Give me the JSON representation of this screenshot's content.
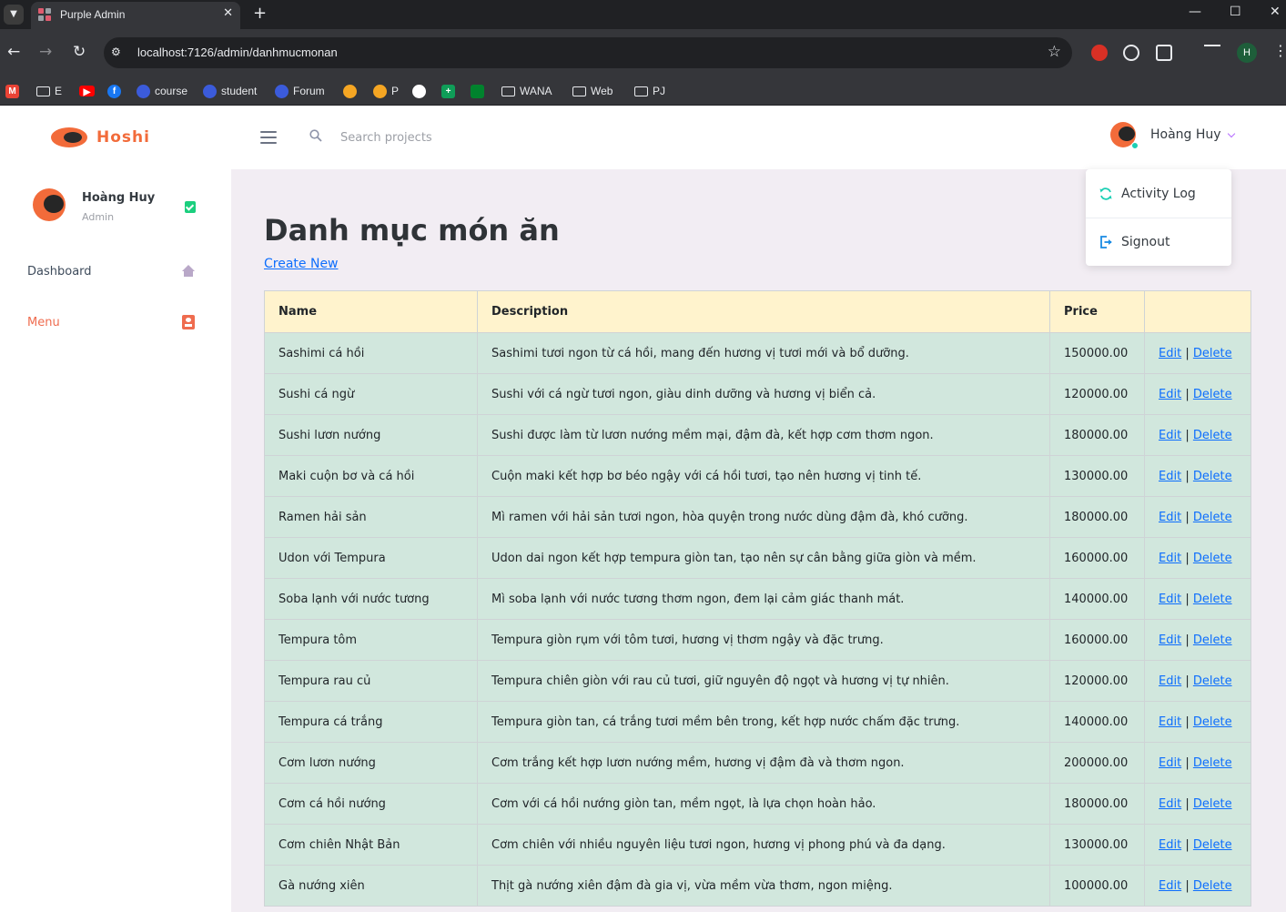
{
  "browser": {
    "tab_title": "Purple Admin",
    "url": "localhost:7126/admin/danhmucmonan",
    "profile_initial": "H",
    "bookmarks": [
      {
        "label": "",
        "icon": "gmail-icon"
      },
      {
        "label": "E",
        "icon": "folder-icon"
      },
      {
        "label": "",
        "icon": "youtube-icon"
      },
      {
        "label": "",
        "icon": "facebook-icon"
      },
      {
        "label": "course",
        "icon": "site-icon"
      },
      {
        "label": "student",
        "icon": "site-icon"
      },
      {
        "label": "Forum",
        "icon": "site-icon"
      },
      {
        "label": "",
        "icon": "site-icon"
      },
      {
        "label": "P",
        "icon": "site-icon"
      },
      {
        "label": "",
        "icon": "openai-icon"
      },
      {
        "label": "",
        "icon": "sheets-icon"
      },
      {
        "label": "",
        "icon": "meet-icon"
      },
      {
        "label": "WANA",
        "icon": "folder-icon"
      },
      {
        "label": "Web",
        "icon": "folder-icon"
      },
      {
        "label": "PJ",
        "icon": "folder-icon"
      }
    ]
  },
  "navbar": {
    "brand": "Hoshi",
    "search_placeholder": "Search projects",
    "profile_name": "Hoàng Huy"
  },
  "dropdown": {
    "items": [
      {
        "label": "Activity Log",
        "icon": "refresh-icon"
      },
      {
        "label": "Signout",
        "icon": "logout-icon"
      }
    ]
  },
  "sidebar": {
    "profile": {
      "name": "Hoàng Huy",
      "role": "Admin"
    },
    "items": [
      {
        "label": "Dashboard",
        "icon": "home-icon",
        "active": false
      },
      {
        "label": "Menu",
        "icon": "menu-book-icon",
        "active": true
      }
    ]
  },
  "main": {
    "title": "Danh mục món ăn",
    "create_link": "Create New",
    "table": {
      "headers": [
        "Name",
        "Description",
        "Price",
        ""
      ],
      "edit_label": "Edit",
      "delete_label": "Delete",
      "separator": "|",
      "rows": [
        {
          "name": "Sashimi cá hồi",
          "description": "Sashimi tươi ngon từ cá hồi, mang đến hương vị tươi mới và bổ dưỡng.",
          "price": "150000.00"
        },
        {
          "name": "Sushi cá ngừ",
          "description": "Sushi với cá ngừ tươi ngon, giàu dinh dưỡng và hương vị biển cả.",
          "price": "120000.00"
        },
        {
          "name": "Sushi lươn nướng",
          "description": "Sushi được làm từ lươn nướng mềm mại, đậm đà, kết hợp cơm thơm ngon.",
          "price": "180000.00"
        },
        {
          "name": "Maki cuộn bơ và cá hồi",
          "description": "Cuộn maki kết hợp bơ béo ngậy với cá hồi tươi, tạo nên hương vị tinh tế.",
          "price": "130000.00"
        },
        {
          "name": "Ramen hải sản",
          "description": "Mì ramen với hải sản tươi ngon, hòa quyện trong nước dùng đậm đà, khó cưỡng.",
          "price": "180000.00"
        },
        {
          "name": "Udon với Tempura",
          "description": "Udon dai ngon kết hợp tempura giòn tan, tạo nên sự cân bằng giữa giòn và mềm.",
          "price": "160000.00"
        },
        {
          "name": "Soba lạnh với nước tương",
          "description": "Mì soba lạnh với nước tương thơm ngon, đem lại cảm giác thanh mát.",
          "price": "140000.00"
        },
        {
          "name": "Tempura tôm",
          "description": "Tempura giòn rụm với tôm tươi, hương vị thơm ngậy và đặc trưng.",
          "price": "160000.00"
        },
        {
          "name": "Tempura rau củ",
          "description": "Tempura chiên giòn với rau củ tươi, giữ nguyên độ ngọt và hương vị tự nhiên.",
          "price": "120000.00"
        },
        {
          "name": "Tempura cá trắng",
          "description": "Tempura giòn tan, cá trắng tươi mềm bên trong, kết hợp nước chấm đặc trưng.",
          "price": "140000.00"
        },
        {
          "name": "Cơm lươn nướng",
          "description": "Cơm trắng kết hợp lươn nướng mềm, hương vị đậm đà và thơm ngon.",
          "price": "200000.00"
        },
        {
          "name": "Cơm cá hồi nướng",
          "description": "Cơm với cá hồi nướng giòn tan, mềm ngọt, là lựa chọn hoàn hảo.",
          "price": "180000.00"
        },
        {
          "name": "Cơm chiên Nhật Bản",
          "description": "Cơm chiên với nhiều nguyên liệu tươi ngon, hương vị phong phú và đa dạng.",
          "price": "130000.00"
        },
        {
          "name": "Gà nướng xiên",
          "description": "Thịt gà nướng xiên đậm đà gia vị, vừa mềm vừa thơm, ngon miệng.",
          "price": "100000.00"
        }
      ]
    }
  }
}
